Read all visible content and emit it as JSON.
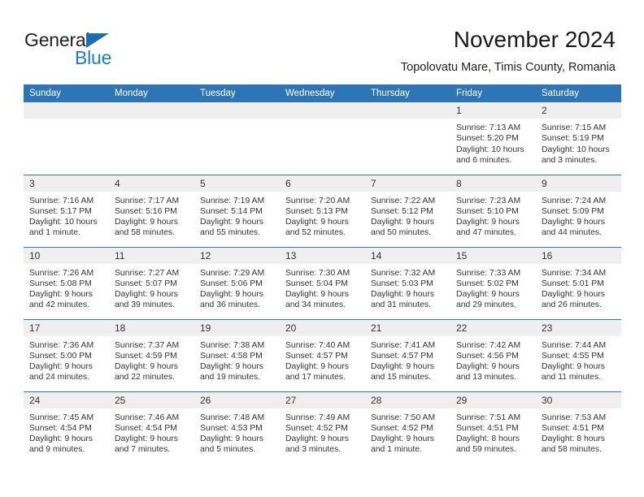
{
  "brand": {
    "name_top": "General",
    "name_bottom": "Blue",
    "triangle_icon": "triangle-icon",
    "color_dark": "#231f20",
    "color_blue": "#1b7ad1"
  },
  "header": {
    "title": "November 2024",
    "subtitle": "Topolovatu Mare, Timis County, Romania"
  },
  "theme": {
    "header_blue": "#2e75b6",
    "daynum_gray": "#efefef",
    "text": "#333333"
  },
  "weekdays": [
    "Sunday",
    "Monday",
    "Tuesday",
    "Wednesday",
    "Thursday",
    "Friday",
    "Saturday"
  ],
  "weeks": [
    [
      {
        "day": "",
        "sunrise": "",
        "sunset": "",
        "daylight": "",
        "daylight2": "",
        "empty": true
      },
      {
        "day": "",
        "sunrise": "",
        "sunset": "",
        "daylight": "",
        "daylight2": "",
        "empty": true
      },
      {
        "day": "",
        "sunrise": "",
        "sunset": "",
        "daylight": "",
        "daylight2": "",
        "empty": true
      },
      {
        "day": "",
        "sunrise": "",
        "sunset": "",
        "daylight": "",
        "daylight2": "",
        "empty": true
      },
      {
        "day": "",
        "sunrise": "",
        "sunset": "",
        "daylight": "",
        "daylight2": "",
        "empty": true
      },
      {
        "day": "1",
        "sunrise": "Sunrise: 7:13 AM",
        "sunset": "Sunset: 5:20 PM",
        "daylight": "Daylight: 10 hours",
        "daylight2": "and 6 minutes.",
        "empty": false
      },
      {
        "day": "2",
        "sunrise": "Sunrise: 7:15 AM",
        "sunset": "Sunset: 5:19 PM",
        "daylight": "Daylight: 10 hours",
        "daylight2": "and 3 minutes.",
        "empty": false
      }
    ],
    [
      {
        "day": "3",
        "sunrise": "Sunrise: 7:16 AM",
        "sunset": "Sunset: 5:17 PM",
        "daylight": "Daylight: 10 hours",
        "daylight2": "and 1 minute.",
        "empty": false
      },
      {
        "day": "4",
        "sunrise": "Sunrise: 7:17 AM",
        "sunset": "Sunset: 5:16 PM",
        "daylight": "Daylight: 9 hours",
        "daylight2": "and 58 minutes.",
        "empty": false
      },
      {
        "day": "5",
        "sunrise": "Sunrise: 7:19 AM",
        "sunset": "Sunset: 5:14 PM",
        "daylight": "Daylight: 9 hours",
        "daylight2": "and 55 minutes.",
        "empty": false
      },
      {
        "day": "6",
        "sunrise": "Sunrise: 7:20 AM",
        "sunset": "Sunset: 5:13 PM",
        "daylight": "Daylight: 9 hours",
        "daylight2": "and 52 minutes.",
        "empty": false
      },
      {
        "day": "7",
        "sunrise": "Sunrise: 7:22 AM",
        "sunset": "Sunset: 5:12 PM",
        "daylight": "Daylight: 9 hours",
        "daylight2": "and 50 minutes.",
        "empty": false
      },
      {
        "day": "8",
        "sunrise": "Sunrise: 7:23 AM",
        "sunset": "Sunset: 5:10 PM",
        "daylight": "Daylight: 9 hours",
        "daylight2": "and 47 minutes.",
        "empty": false
      },
      {
        "day": "9",
        "sunrise": "Sunrise: 7:24 AM",
        "sunset": "Sunset: 5:09 PM",
        "daylight": "Daylight: 9 hours",
        "daylight2": "and 44 minutes.",
        "empty": false
      }
    ],
    [
      {
        "day": "10",
        "sunrise": "Sunrise: 7:26 AM",
        "sunset": "Sunset: 5:08 PM",
        "daylight": "Daylight: 9 hours",
        "daylight2": "and 42 minutes.",
        "empty": false
      },
      {
        "day": "11",
        "sunrise": "Sunrise: 7:27 AM",
        "sunset": "Sunset: 5:07 PM",
        "daylight": "Daylight: 9 hours",
        "daylight2": "and 39 minutes.",
        "empty": false
      },
      {
        "day": "12",
        "sunrise": "Sunrise: 7:29 AM",
        "sunset": "Sunset: 5:06 PM",
        "daylight": "Daylight: 9 hours",
        "daylight2": "and 36 minutes.",
        "empty": false
      },
      {
        "day": "13",
        "sunrise": "Sunrise: 7:30 AM",
        "sunset": "Sunset: 5:04 PM",
        "daylight": "Daylight: 9 hours",
        "daylight2": "and 34 minutes.",
        "empty": false
      },
      {
        "day": "14",
        "sunrise": "Sunrise: 7:32 AM",
        "sunset": "Sunset: 5:03 PM",
        "daylight": "Daylight: 9 hours",
        "daylight2": "and 31 minutes.",
        "empty": false
      },
      {
        "day": "15",
        "sunrise": "Sunrise: 7:33 AM",
        "sunset": "Sunset: 5:02 PM",
        "daylight": "Daylight: 9 hours",
        "daylight2": "and 29 minutes.",
        "empty": false
      },
      {
        "day": "16",
        "sunrise": "Sunrise: 7:34 AM",
        "sunset": "Sunset: 5:01 PM",
        "daylight": "Daylight: 9 hours",
        "daylight2": "and 26 minutes.",
        "empty": false
      }
    ],
    [
      {
        "day": "17",
        "sunrise": "Sunrise: 7:36 AM",
        "sunset": "Sunset: 5:00 PM",
        "daylight": "Daylight: 9 hours",
        "daylight2": "and 24 minutes.",
        "empty": false
      },
      {
        "day": "18",
        "sunrise": "Sunrise: 7:37 AM",
        "sunset": "Sunset: 4:59 PM",
        "daylight": "Daylight: 9 hours",
        "daylight2": "and 22 minutes.",
        "empty": false
      },
      {
        "day": "19",
        "sunrise": "Sunrise: 7:38 AM",
        "sunset": "Sunset: 4:58 PM",
        "daylight": "Daylight: 9 hours",
        "daylight2": "and 19 minutes.",
        "empty": false
      },
      {
        "day": "20",
        "sunrise": "Sunrise: 7:40 AM",
        "sunset": "Sunset: 4:57 PM",
        "daylight": "Daylight: 9 hours",
        "daylight2": "and 17 minutes.",
        "empty": false
      },
      {
        "day": "21",
        "sunrise": "Sunrise: 7:41 AM",
        "sunset": "Sunset: 4:57 PM",
        "daylight": "Daylight: 9 hours",
        "daylight2": "and 15 minutes.",
        "empty": false
      },
      {
        "day": "22",
        "sunrise": "Sunrise: 7:42 AM",
        "sunset": "Sunset: 4:56 PM",
        "daylight": "Daylight: 9 hours",
        "daylight2": "and 13 minutes.",
        "empty": false
      },
      {
        "day": "23",
        "sunrise": "Sunrise: 7:44 AM",
        "sunset": "Sunset: 4:55 PM",
        "daylight": "Daylight: 9 hours",
        "daylight2": "and 11 minutes.",
        "empty": false
      }
    ],
    [
      {
        "day": "24",
        "sunrise": "Sunrise: 7:45 AM",
        "sunset": "Sunset: 4:54 PM",
        "daylight": "Daylight: 9 hours",
        "daylight2": "and 9 minutes.",
        "empty": false
      },
      {
        "day": "25",
        "sunrise": "Sunrise: 7:46 AM",
        "sunset": "Sunset: 4:54 PM",
        "daylight": "Daylight: 9 hours",
        "daylight2": "and 7 minutes.",
        "empty": false
      },
      {
        "day": "26",
        "sunrise": "Sunrise: 7:48 AM",
        "sunset": "Sunset: 4:53 PM",
        "daylight": "Daylight: 9 hours",
        "daylight2": "and 5 minutes.",
        "empty": false
      },
      {
        "day": "27",
        "sunrise": "Sunrise: 7:49 AM",
        "sunset": "Sunset: 4:52 PM",
        "daylight": "Daylight: 9 hours",
        "daylight2": "and 3 minutes.",
        "empty": false
      },
      {
        "day": "28",
        "sunrise": "Sunrise: 7:50 AM",
        "sunset": "Sunset: 4:52 PM",
        "daylight": "Daylight: 9 hours",
        "daylight2": "and 1 minute.",
        "empty": false
      },
      {
        "day": "29",
        "sunrise": "Sunrise: 7:51 AM",
        "sunset": "Sunset: 4:51 PM",
        "daylight": "Daylight: 8 hours",
        "daylight2": "and 59 minutes.",
        "empty": false
      },
      {
        "day": "30",
        "sunrise": "Sunrise: 7:53 AM",
        "sunset": "Sunset: 4:51 PM",
        "daylight": "Daylight: 8 hours",
        "daylight2": "and 58 minutes.",
        "empty": false
      }
    ]
  ]
}
